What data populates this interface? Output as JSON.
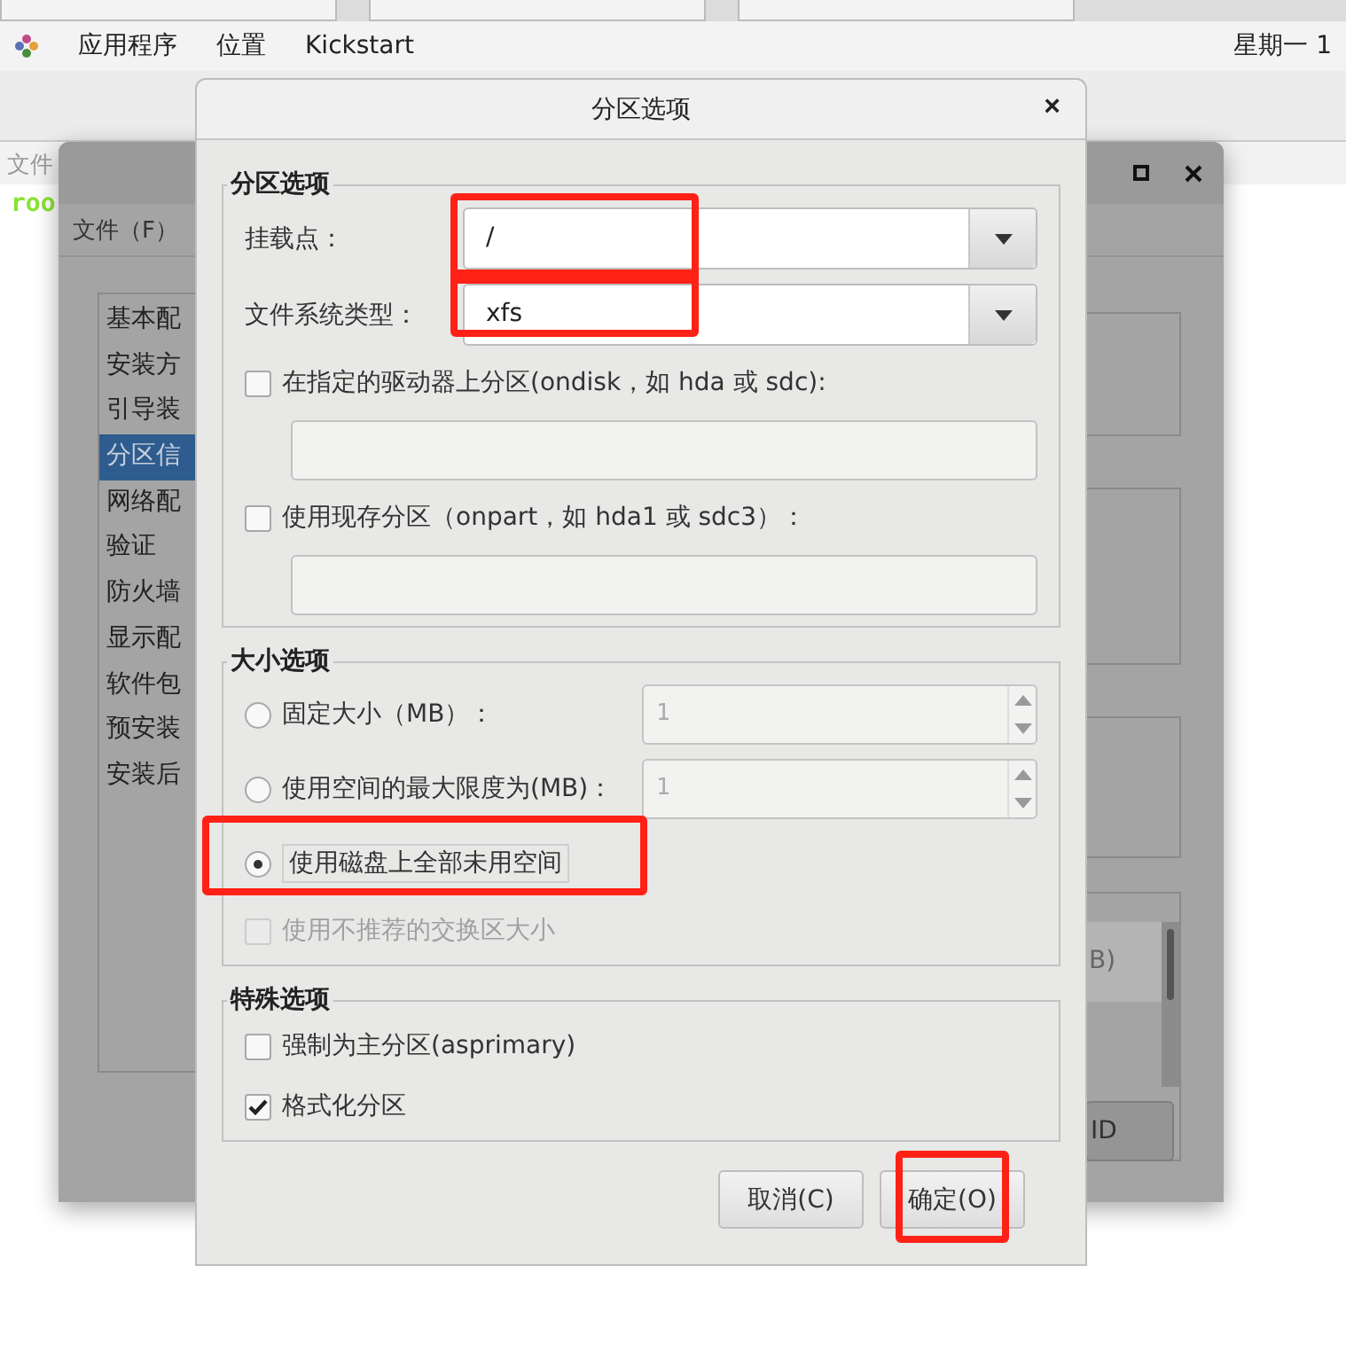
{
  "top_bar": {
    "menu": [
      "应用程序",
      "位置",
      "Kickstart"
    ],
    "clock": "星期一 1"
  },
  "terminal": {
    "menu": "文件",
    "prompt": "roo"
  },
  "background_window": {
    "menu": "文件（F）",
    "sidebar": [
      {
        "label": "基本配",
        "selected": false
      },
      {
        "label": "安装方",
        "selected": false
      },
      {
        "label": "引导装",
        "selected": false
      },
      {
        "label": "分区信",
        "selected": true
      },
      {
        "label": "网络配",
        "selected": false
      },
      {
        "label": "验证",
        "selected": false
      },
      {
        "label": "防火墙",
        "selected": false
      },
      {
        "label": "显示配",
        "selected": false
      },
      {
        "label": "软件包",
        "selected": false
      },
      {
        "label": "预安装",
        "selected": false
      },
      {
        "label": "安装后",
        "selected": false
      }
    ],
    "list_fragment": "B)",
    "button_fragment": "ID"
  },
  "dialog": {
    "title": "分区选项",
    "close": "×",
    "groups": [
      {
        "title": "分区选项",
        "rows": [
          {
            "kind": "combo",
            "label": "挂载点：",
            "value": "/",
            "annotated": true
          },
          {
            "kind": "combo",
            "label": "文件系统类型：",
            "value": "xfs",
            "annotated": true
          },
          {
            "kind": "check",
            "label": "在指定的驱动器上分区(ondisk，如 hda 或 sdc):",
            "checked": false,
            "disabled": false
          },
          {
            "kind": "field",
            "disabled": true
          },
          {
            "kind": "check",
            "label": "使用现存分区（onpart，如 hda1 或 sdc3）：",
            "checked": false,
            "disabled": false
          },
          {
            "kind": "field",
            "disabled": true
          }
        ]
      },
      {
        "title": "大小选项",
        "rows": [
          {
            "kind": "radio",
            "label": "固定大小（MB）：",
            "selected": false,
            "spin": {
              "value": "1",
              "disabled": true
            }
          },
          {
            "kind": "radio",
            "label": "使用空间的最大限度为(MB)：",
            "selected": false,
            "spin": {
              "value": "1",
              "disabled": true
            }
          },
          {
            "kind": "radio",
            "label": "使用磁盘上全部未用空间",
            "selected": true,
            "annotated": true
          },
          {
            "kind": "check",
            "label": "使用不推荐的交换区大小",
            "checked": false,
            "disabled": true
          }
        ]
      },
      {
        "title": "特殊选项",
        "rows": [
          {
            "kind": "check",
            "label": "强制为主分区(asprimary)",
            "checked": false,
            "disabled": false
          },
          {
            "kind": "check",
            "label": "格式化分区",
            "checked": true,
            "disabled": false
          }
        ]
      }
    ],
    "buttons": [
      {
        "label": "取消(C)",
        "annotated": false
      },
      {
        "label": "确定(O)",
        "annotated": true
      }
    ]
  }
}
